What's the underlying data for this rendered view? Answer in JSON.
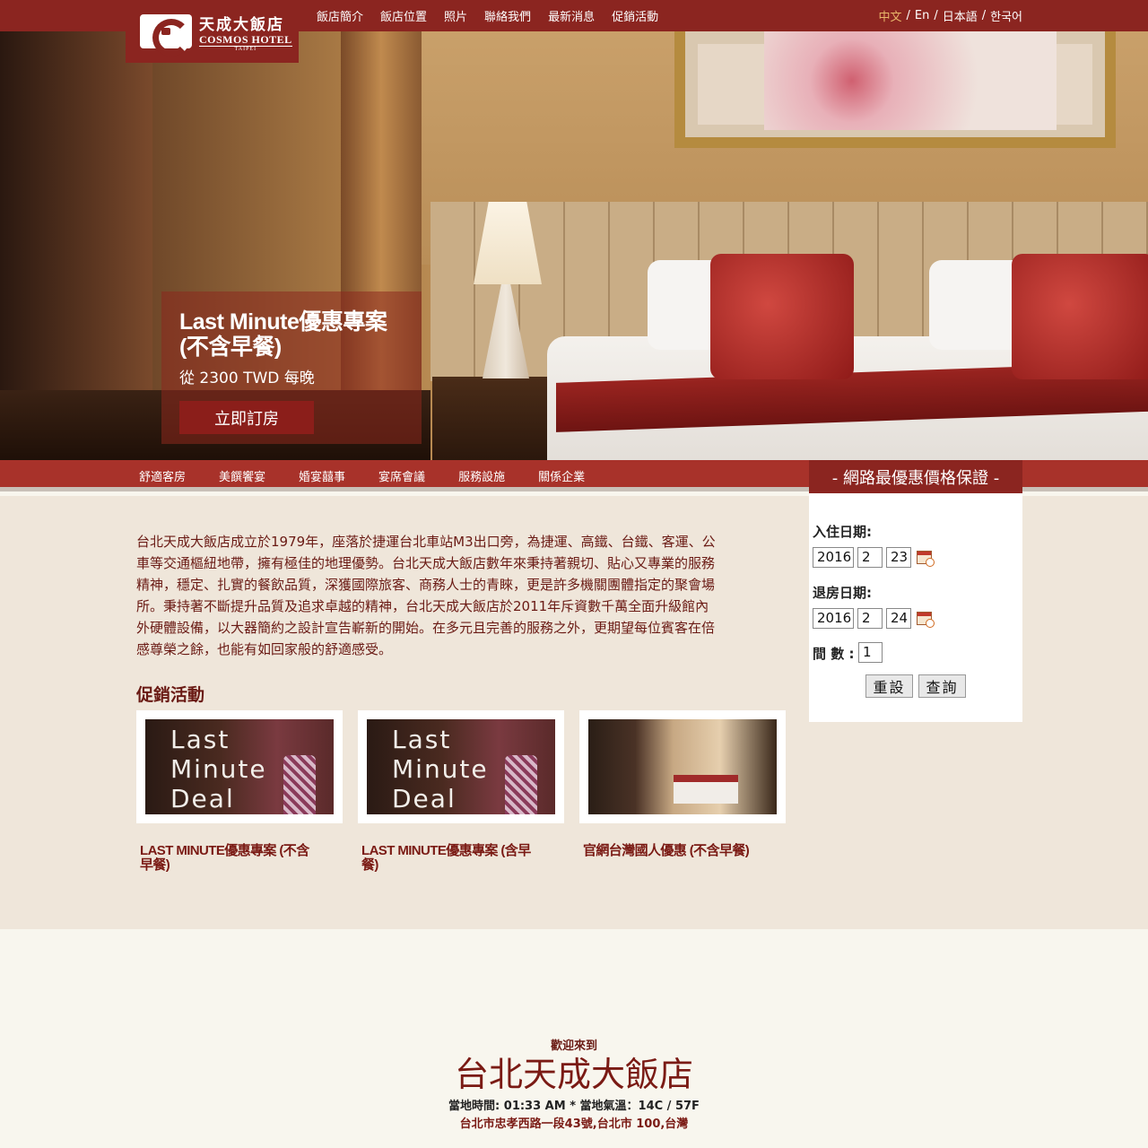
{
  "brand": {
    "logo_cn": "天成大飯店",
    "logo_en": "COSMOS HOTEL",
    "logo_sub": "TAIPEI",
    "primary_color": "#8b2520"
  },
  "top_nav": [
    "飯店簡介",
    "飯店位置",
    "照片",
    "聯絡我們",
    "最新消息",
    "促銷活動"
  ],
  "languages": [
    {
      "label": "中文",
      "active": true
    },
    {
      "label": "En",
      "active": false
    },
    {
      "label": "日本語",
      "active": false
    },
    {
      "label": "한국어",
      "active": false
    }
  ],
  "language_separator": "/",
  "hero": {
    "promo_title": "Last Minute優惠專案(不含早餐)",
    "promo_price": "從 2300 TWD 每晚",
    "book_button": "立即訂房"
  },
  "sub_nav": [
    "舒適客房",
    "美饌饗宴",
    "婚宴囍事",
    "宴席會議",
    "服務設施",
    "關係企業"
  ],
  "intro_text": "台北天成大飯店成立於1979年，座落於捷運台北車站M3出口旁，為捷運、高鐵、台鐵、客運、公車等交通樞紐地帶，擁有極佳的地理優勢。台北天成大飯店數年來秉持著親切、貼心又專業的服務精神，穩定、扎實的餐飲品質，深獲國際旅客、商務人士的青睞，更是許多機關團體指定的聚會場所。秉持著不斷提升品質及追求卓越的精神，台北天成大飯店於2011年斥資數千萬全面升級館內外硬體設備，以大器簡約之設計宣告嶄新的開始。在多元且完善的服務之外，更期望每位賓客在倍感尊榮之餘，也能有如回家般的舒適感受。",
  "promotions": {
    "title": "促銷活動",
    "items": [
      {
        "image": "deal",
        "image_text": [
          "Last",
          "Minute",
          "Deal"
        ],
        "label": "LAST MINUTE優惠專案 (不含早餐)"
      },
      {
        "image": "deal",
        "image_text": [
          "Last",
          "Minute",
          "Deal"
        ],
        "label": "LAST MINUTE優惠專案 (含早餐)"
      },
      {
        "image": "room",
        "image_text": [],
        "label": "官網台灣國人優惠 (不含早餐)"
      }
    ]
  },
  "booking": {
    "guarantee": "- 網路最優惠價格保證 -",
    "checkin_label": "入住日期:",
    "checkin": {
      "year": "2016",
      "month": "2",
      "day": "23"
    },
    "checkout_label": "退房日期:",
    "checkout": {
      "year": "2016",
      "month": "2",
      "day": "24"
    },
    "rooms_label": "間 數 :",
    "rooms": "1",
    "reset_button": "重設",
    "search_button": "查詢"
  },
  "footer": {
    "welcome": "歡迎來到",
    "hotel_name": "台北天成大飯店",
    "time_weather": "當地時間: 01:33 AM * 當地氣溫：14C / 57F",
    "address": "台北市忠孝西路一段43號,台北市 100,台灣"
  }
}
